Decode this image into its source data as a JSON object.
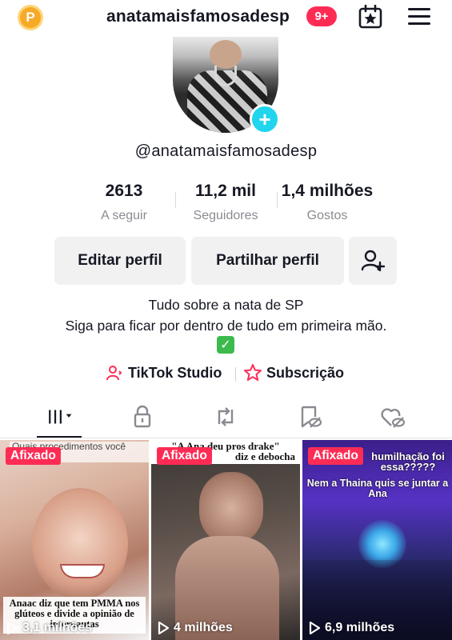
{
  "header": {
    "points_badge": "P",
    "username": "anatamaisfamosadesp",
    "notifications": "9+"
  },
  "profile": {
    "handle": "@anatamaisfamosadesp",
    "stats": [
      {
        "value": "2613",
        "label": "A seguir"
      },
      {
        "value": "11,2 mil",
        "label": "Seguidores"
      },
      {
        "value": "1,4 milhões",
        "label": "Gostos"
      }
    ],
    "buttons": {
      "edit": "Editar perfil",
      "share": "Partilhar perfil"
    },
    "bio_line1": "Tudo sobre a nata de SP",
    "bio_line2": "Siga para ficar por dentro de tudo em primeira mão.",
    "links": {
      "studio": "TikTok Studio",
      "subscription": "Subscrição"
    }
  },
  "videos": [
    {
      "pinned": "Afixado",
      "views": "3,1 milhões",
      "top_caption": "Quais procedimentos você tem?",
      "bottom_caption": "Anaac diz que tem PMMA nos glúteos e divide a opinião de internautas"
    },
    {
      "pinned": "Afixado",
      "views": "4 milhões",
      "top_caption": "\"A Ana deu pros drake\"",
      "top_caption_2": "diz e debocha"
    },
    {
      "pinned": "Afixado",
      "views": "6,9 milhões",
      "top_caption": "humilhação foi essa?????",
      "top_caption_2": "Nem a Thaina quis se juntar a Ana"
    }
  ],
  "colors": {
    "accent": "#fe2c55",
    "avatar_add": "#20d5ec",
    "points": "#f7a928"
  }
}
